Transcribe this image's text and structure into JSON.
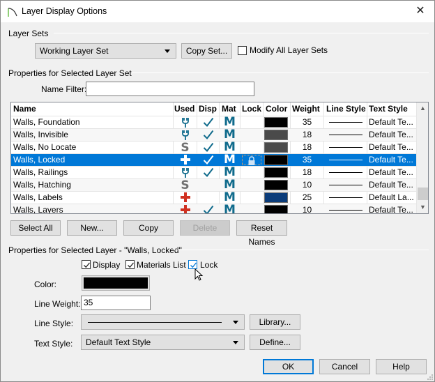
{
  "window": {
    "title": "Layer Display Options",
    "close_label": "✕"
  },
  "layer_sets": {
    "group_label": "Layer Sets",
    "selected_set": "Working Layer Set",
    "copy_set_label": "Copy Set...",
    "modify_all_label": "Modify All Layer Sets",
    "modify_all_checked": false
  },
  "props_set": {
    "group_label": "Properties for Selected Layer Set",
    "name_filter_label": "Name Filter:",
    "name_filter_value": ""
  },
  "table": {
    "columns": [
      "Name",
      "Used",
      "Disp",
      "Mat",
      "Lock",
      "Color",
      "Weight",
      "Line Style",
      "Text Style"
    ],
    "sort_indicator": "^",
    "rows": [
      {
        "name": "Walls,  Foundation",
        "used": "plug",
        "disp": true,
        "mat": "M",
        "lock": false,
        "color": "#000000",
        "weight": "35",
        "text_style": "Default Te...",
        "selected": false
      },
      {
        "name": "Walls,  Invisible",
        "used": "plug",
        "disp": true,
        "mat": "M",
        "lock": false,
        "color": "#4a4a4a",
        "weight": "18",
        "text_style": "Default Te...",
        "selected": false
      },
      {
        "name": "Walls,  No Locate",
        "used": "S",
        "disp": true,
        "mat": "M",
        "lock": false,
        "color": "#4a4a4a",
        "weight": "18",
        "text_style": "Default Te...",
        "selected": false
      },
      {
        "name": "Walls,  Locked",
        "used": "plus",
        "disp": true,
        "mat": "M",
        "lock": true,
        "color": "#000000",
        "weight": "35",
        "text_style": "Default Te...",
        "selected": true
      },
      {
        "name": "Walls,  Railings",
        "used": "plug",
        "disp": true,
        "mat": "M",
        "lock": false,
        "color": "#000000",
        "weight": "18",
        "text_style": "Default Te...",
        "selected": false
      },
      {
        "name": "Walls, Hatching",
        "used": "S",
        "disp": false,
        "mat": "M",
        "lock": false,
        "color": "#000000",
        "weight": "10",
        "text_style": "Default Te...",
        "selected": false
      },
      {
        "name": "Walls, Labels",
        "used": "plus",
        "disp": false,
        "mat": "M",
        "lock": false,
        "color": "#0b3c7a",
        "weight": "25",
        "text_style": "Default La...",
        "selected": false
      },
      {
        "name": "Walls, Layers",
        "used": "plus",
        "disp": true,
        "mat": "M",
        "lock": false,
        "color": "#000000",
        "weight": "10",
        "text_style": "Default Te...",
        "selected": false
      }
    ]
  },
  "table_buttons": {
    "select_all": "Select All",
    "new": "New...",
    "copy": "Copy",
    "delete": "Delete",
    "reset_names": "Reset Names"
  },
  "props_layer": {
    "group_label": "Properties for Selected Layer - \"Walls,  Locked\"",
    "display_label": "Display",
    "display_checked": true,
    "materials_label": "Materials List",
    "materials_checked": true,
    "lock_label": "Lock",
    "lock_checked": true,
    "color_label": "Color:",
    "color_value": "#000000",
    "line_weight_label": "Line Weight:",
    "line_weight_value": "35",
    "line_style_label": "Line Style:",
    "library_label": "Library...",
    "text_style_label": "Text Style:",
    "text_style_value": "Default Text Style",
    "define_label": "Define..."
  },
  "footer": {
    "ok": "OK",
    "cancel": "Cancel",
    "help": "Help"
  },
  "colors": {
    "accent": "#0078d7",
    "icon_teal": "#106b8c",
    "icon_red": "#d03020",
    "icon_gray": "#707070"
  }
}
